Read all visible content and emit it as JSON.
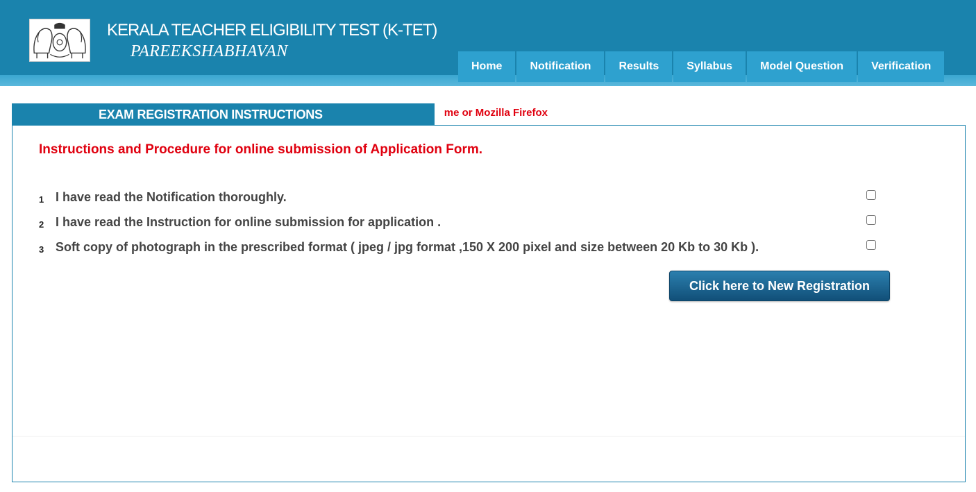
{
  "header": {
    "title": "KERALA TEACHER ELIGIBILITY TEST (K-TET)",
    "subtitle": "PAREEKSHABHAVAN",
    "logo_icon": "kerala-emblem-icon",
    "background_color": "#1a83ad"
  },
  "nav": {
    "items": [
      {
        "label": "Home"
      },
      {
        "label": "Notification"
      },
      {
        "label": "Results"
      },
      {
        "label": "Syllabus"
      },
      {
        "label": "Model Question"
      },
      {
        "label": "Verification"
      }
    ],
    "item_color": "#2ea1cf"
  },
  "notice": {
    "text": "me or Mozilla Firefox",
    "color": "#e0000f"
  },
  "tab": {
    "label": "EXAM REGISTRATION INSTRUCTIONS"
  },
  "instructions": {
    "heading": "Instructions and Procedure for online submission of Application Form.",
    "items": [
      {
        "num": "1",
        "text": "I have read the Notification thoroughly.",
        "checked": false
      },
      {
        "num": "2",
        "text": "I have read the Instruction for online submission for application .",
        "checked": false
      },
      {
        "num": "3",
        "text": "Soft copy of photograph in the prescribed format ( jpeg / jpg format ,150 X 200 pixel and size between 20 Kb to 30 Kb ).",
        "checked": false
      }
    ]
  },
  "register_button": {
    "label": "Click here to New Registration"
  }
}
